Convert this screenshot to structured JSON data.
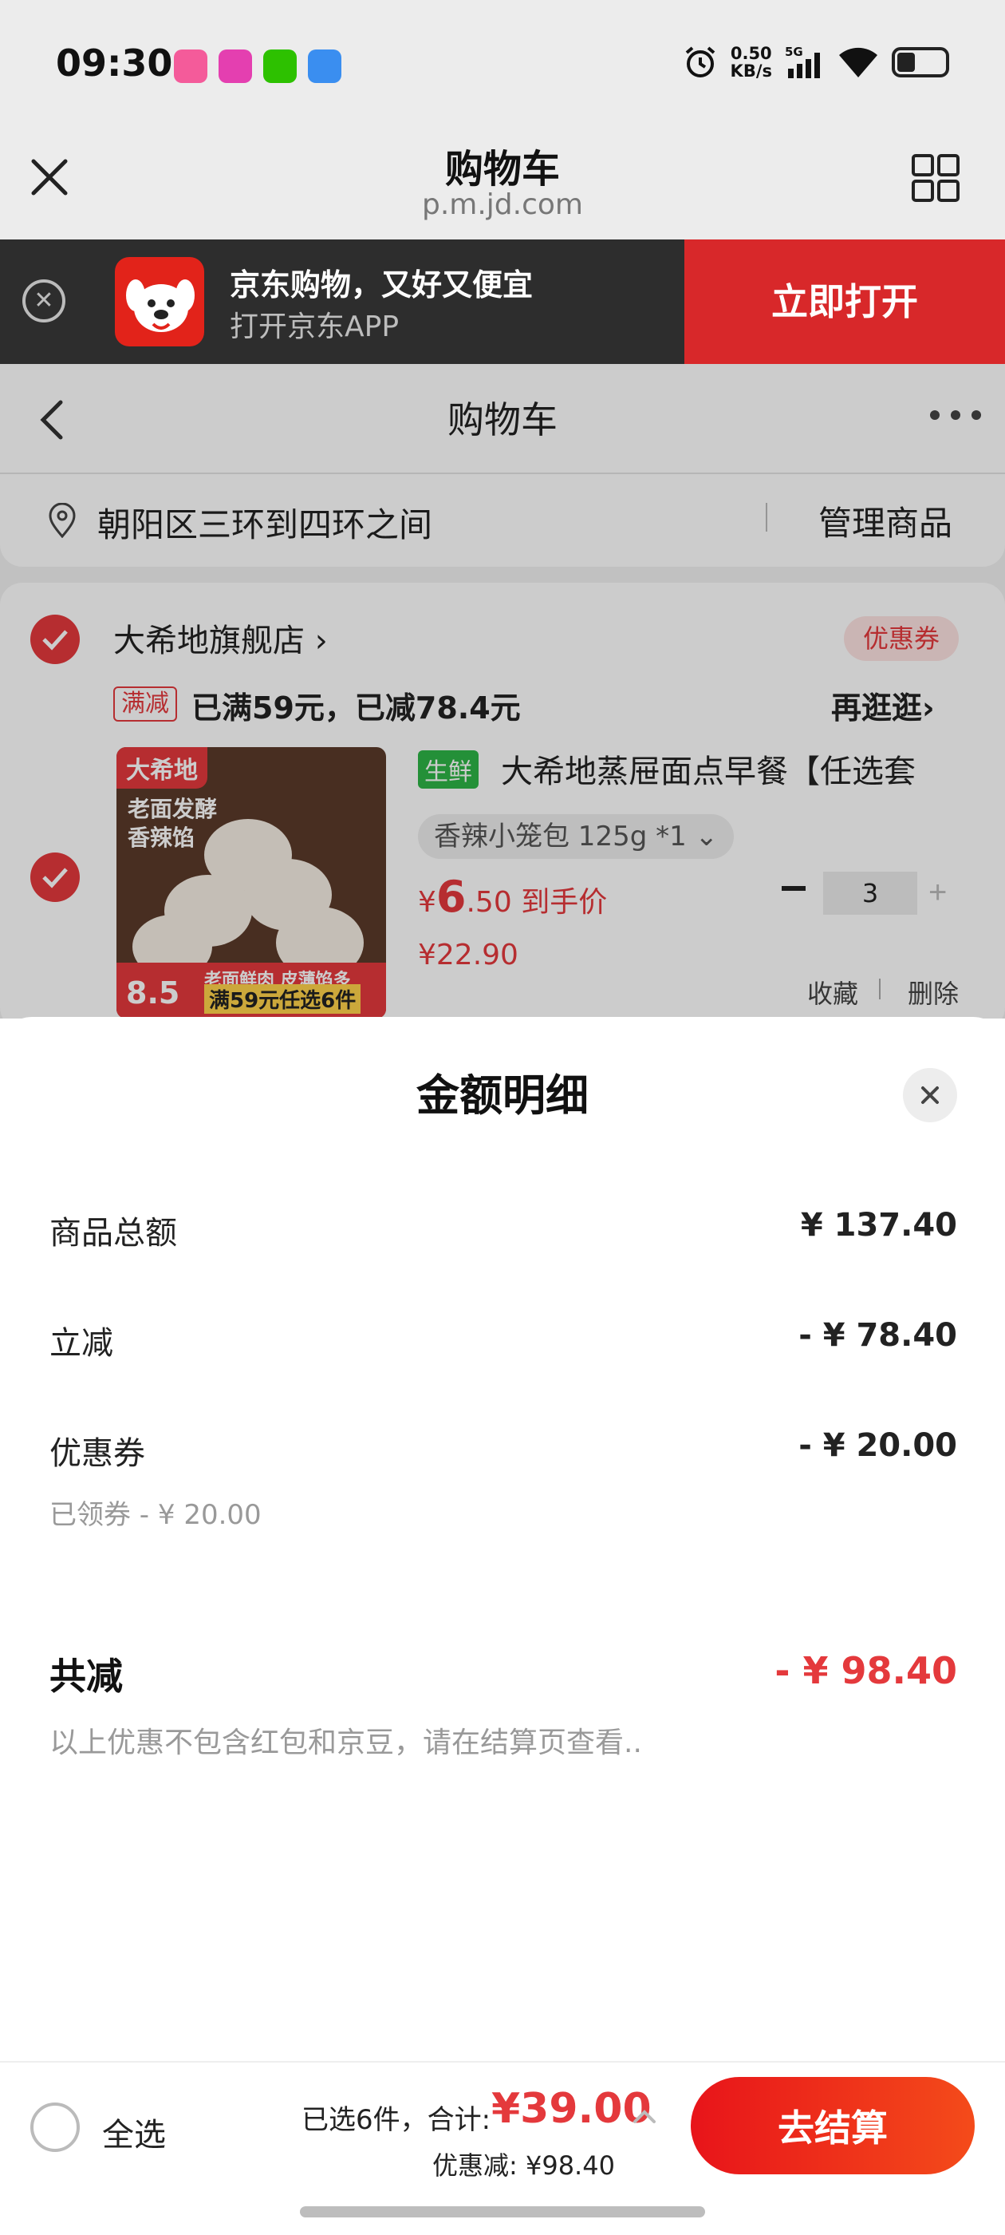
{
  "status_bar": {
    "time": "09:30",
    "net_speed_value": "0.50",
    "net_speed_unit": "KB/s",
    "network": "5G"
  },
  "browser": {
    "title": "购物车",
    "url": "p.m.jd.com"
  },
  "app_banner": {
    "headline": "京东购物，又好又便宜",
    "subline": "打开京东APP",
    "open_button": "立即打开"
  },
  "cart_page": {
    "nav_title": "购物车",
    "address": "朝阳区三环到四环之间",
    "manage_label": "管理商品",
    "shop": {
      "name": "大希地旗舰店",
      "coupon_tag": "优惠券",
      "promo_badge": "满减",
      "promo_text": "已满59元，已减78.4元",
      "promo_more": "再逛逛"
    },
    "product": {
      "tag": "生鲜",
      "title": "大希地蒸屉面点早餐【任选套",
      "spec": "香辣小笼包 125g *1",
      "price_currency": "¥",
      "price_int": "6",
      "price_dec": ".50",
      "price_suffix": "到手价",
      "orig_price": "¥22.90",
      "quantity": "3",
      "favorite_label": "收藏",
      "delete_label": "删除",
      "image": {
        "brand": "大希地",
        "headline_1": "老面发酵",
        "headline_2": "香辣馅",
        "price_badge": "8.5",
        "bottom_text_1": "老面鲜肉 皮薄馅多",
        "bottom_text_2": "满59元任选6件"
      }
    }
  },
  "sheet": {
    "title": "金额明细",
    "rows": [
      {
        "label": "商品总额",
        "value": "¥ 137.40"
      },
      {
        "label": "立减",
        "value": "- ¥ 78.40"
      },
      {
        "label": "优惠券",
        "value": "- ¥ 20.00",
        "note": "已领券 - ¥ 20.00"
      }
    ],
    "total_label": "共减",
    "total_value": "- ¥ 98.40",
    "disclaimer": "以上优惠不包含红包和京豆，请在结算页查看.."
  },
  "checkout": {
    "select_all": "全选",
    "summary": "已选6件，合计:",
    "total": "¥39.00",
    "discount_label": "优惠减:",
    "discount_value": "¥98.40",
    "button": "去结算"
  },
  "colors": {
    "jd_red": "#e4393c",
    "banner_red": "#d8282a",
    "fresh_green": "#2db546"
  }
}
